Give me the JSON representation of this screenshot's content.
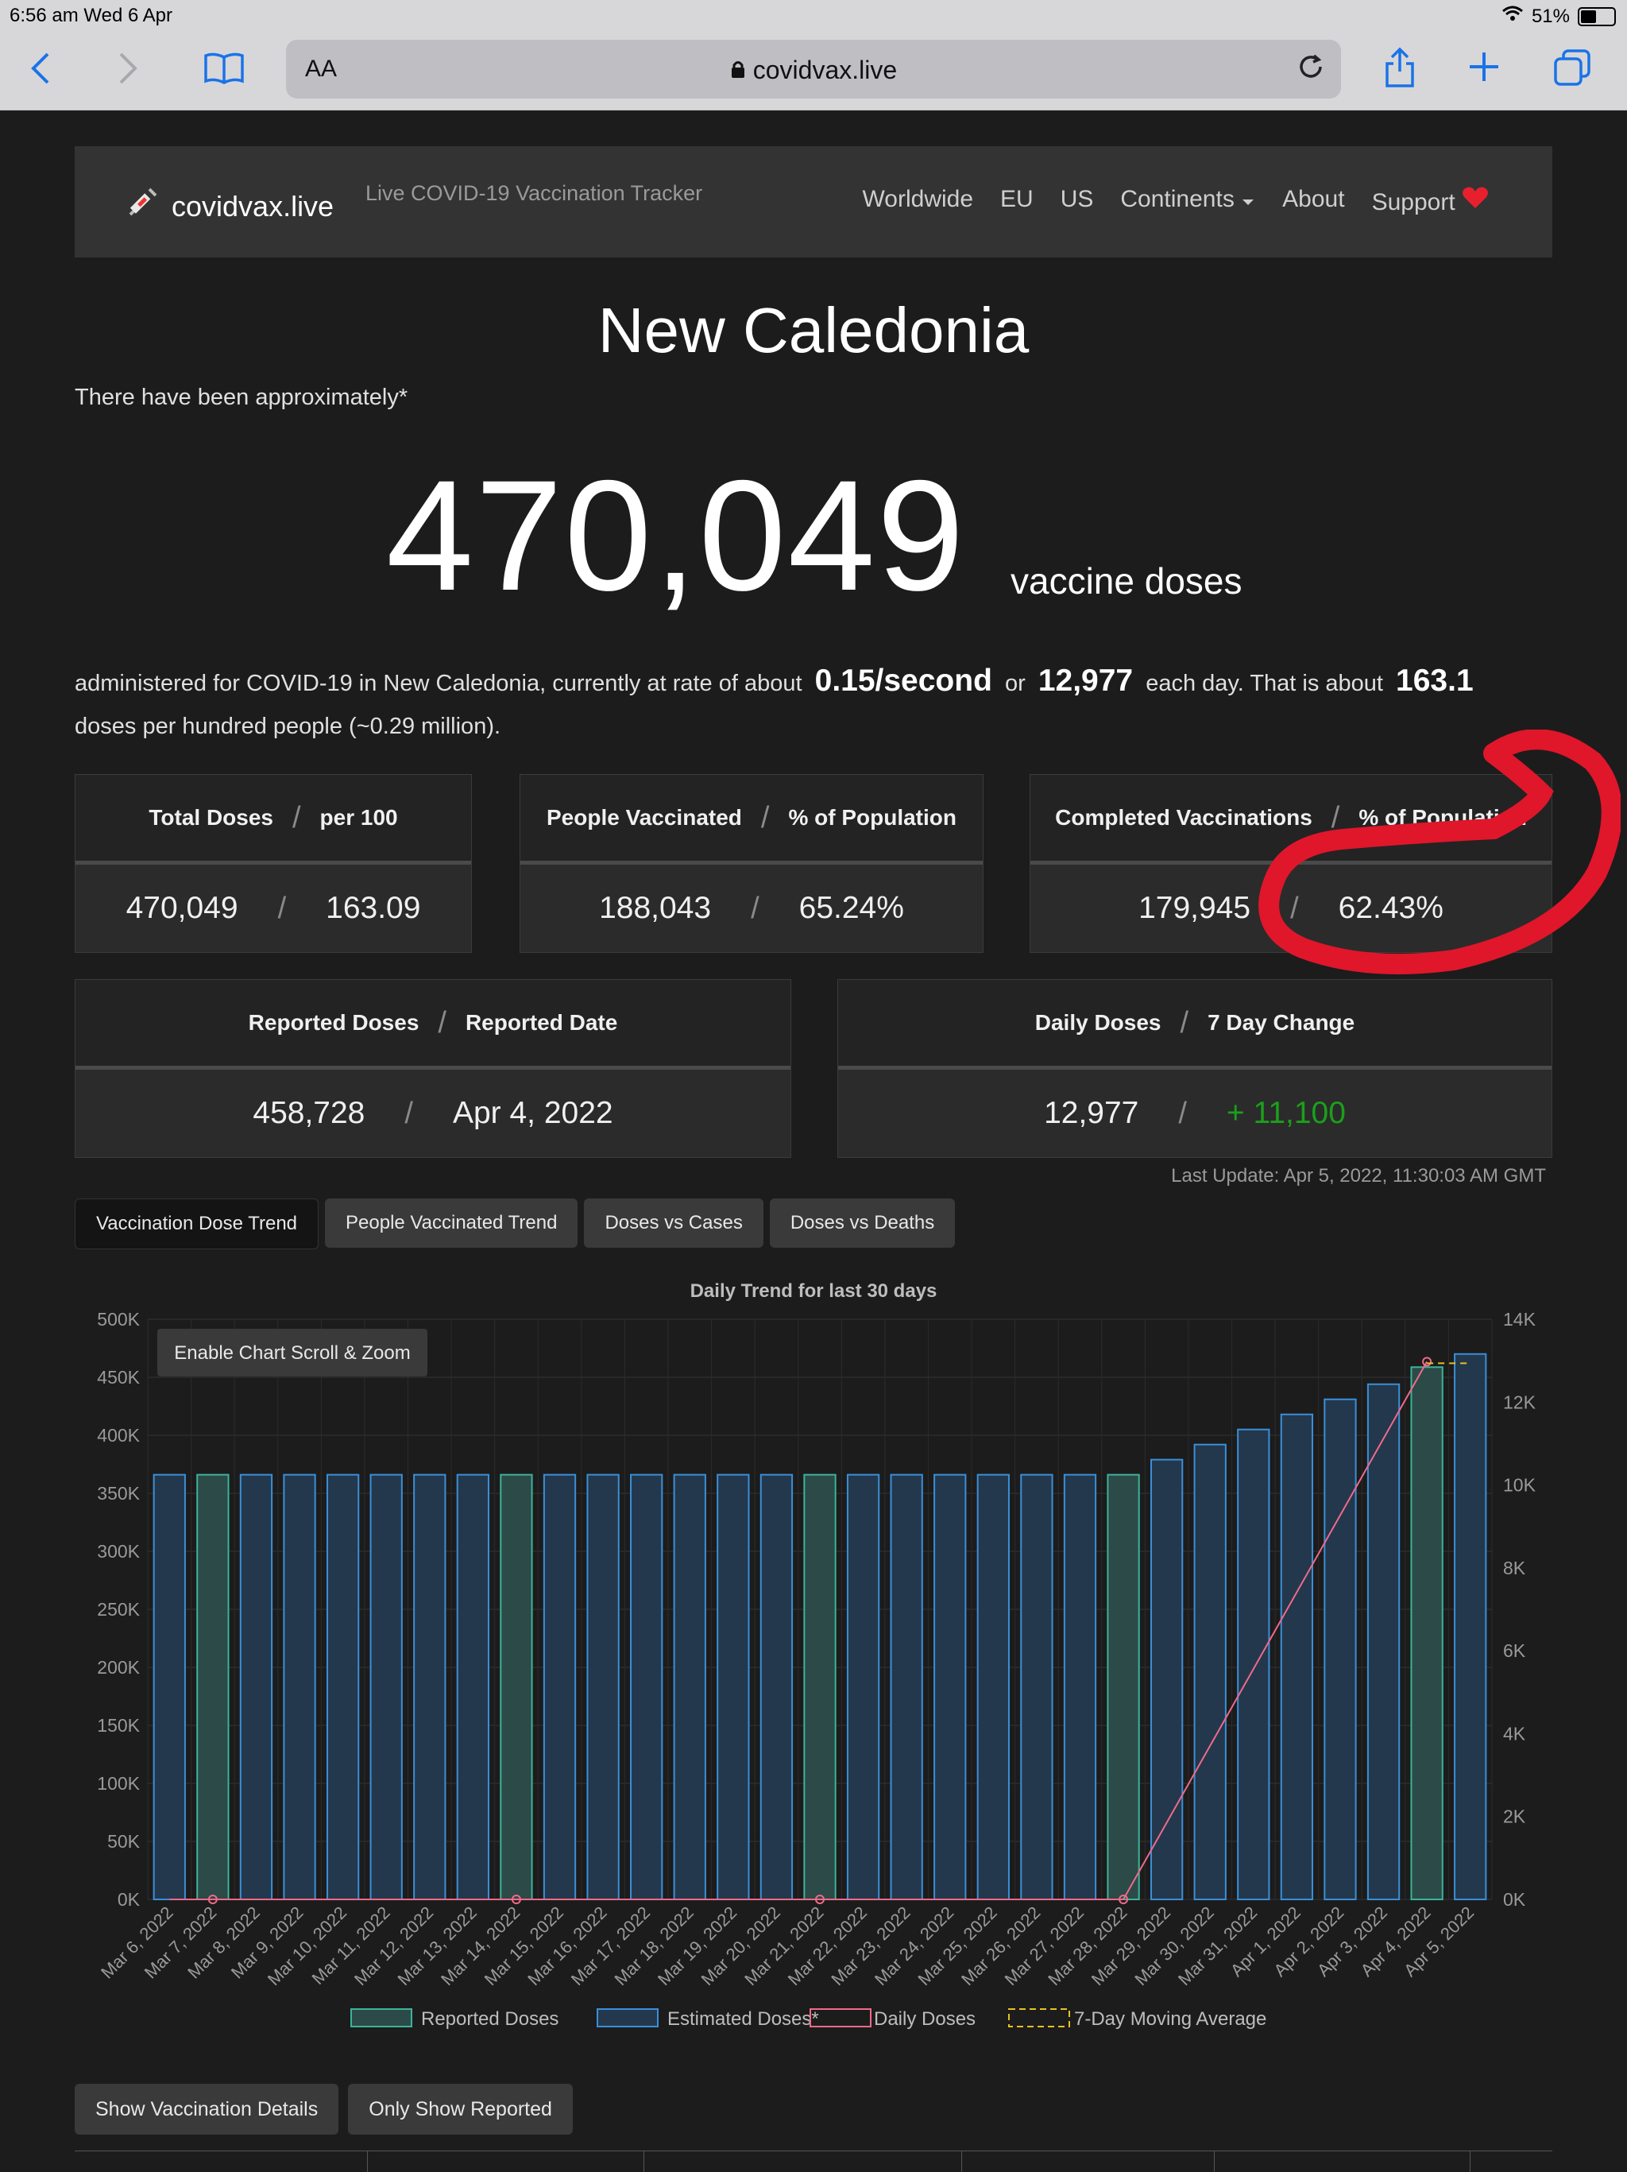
{
  "status": {
    "time": "6:56 am  Wed 6 Apr",
    "battery": "51%",
    "battery_level": 0.51
  },
  "safari": {
    "text_size": "AA",
    "url": "covidvax.live"
  },
  "nav": {
    "brand": "covidvax.live",
    "tagline": "Live COVID-19 Vaccination Tracker",
    "links": [
      "Worldwide",
      "EU",
      "US",
      "Continents",
      "About",
      "Support"
    ]
  },
  "country": "New Caledonia",
  "intro": "There have been approximately*",
  "big_number": "470,049",
  "big_suffix": "vaccine doses",
  "rate": {
    "text1": "administered for COVID-19 in New Caledonia, currently at rate of about",
    "per_second": "0.15/second",
    "or": "or",
    "per_day": "12,977",
    "text2": "each day.  That is about",
    "per_hundred": "163.1",
    "text3": "doses per hundred people (~0.29 million)."
  },
  "cards": {
    "total": {
      "h1": "Total Doses",
      "h2": "per 100",
      "v1": "470,049",
      "v2": "163.09"
    },
    "people": {
      "h1": "People Vaccinated",
      "h2": "% of Population",
      "v1": "188,043",
      "v2": "65.24%"
    },
    "completed": {
      "h1": "Completed Vaccinations",
      "h2": "% of Population",
      "v1": "179,945",
      "v2": "62.43%"
    },
    "reported": {
      "h1": "Reported Doses",
      "h2": "Reported Date",
      "v1": "458,728",
      "v2": "Apr 4, 2022"
    },
    "daily": {
      "h1": "Daily Doses",
      "h2": "7 Day Change",
      "v1": "12,977",
      "v2": "+ 11,100"
    }
  },
  "slash": "/",
  "last_update": "Last Update: Apr 5, 2022, 11:30:03 AM GMT",
  "tabs": [
    "Vaccination Dose Trend",
    "People Vaccinated Trend",
    "Doses vs Cases",
    "Doses vs Deaths"
  ],
  "zoom_button": "Enable Chart Scroll & Zoom",
  "buttons": {
    "details": "Show Vaccination Details",
    "reported": "Only Show Reported"
  },
  "colors": {
    "reported_bar": "#3cb39a",
    "estimated_bar": "#3a8fd8",
    "daily_line": "#f06a8a",
    "moving_avg": "#e8c020",
    "positive_change": "#1aa01a",
    "annotation": "#e0162b"
  },
  "chart_data": {
    "type": "bar",
    "title": "Daily Trend for last 30 days",
    "categories": [
      "Mar 6, 2022",
      "Mar 7, 2022",
      "Mar 8, 2022",
      "Mar 9, 2022",
      "Mar 10, 2022",
      "Mar 11, 2022",
      "Mar 12, 2022",
      "Mar 13, 2022",
      "Mar 14, 2022",
      "Mar 15, 2022",
      "Mar 16, 2022",
      "Mar 17, 2022",
      "Mar 18, 2022",
      "Mar 19, 2022",
      "Mar 20, 2022",
      "Mar 21, 2022",
      "Mar 22, 2022",
      "Mar 23, 2022",
      "Mar 24, 2022",
      "Mar 25, 2022",
      "Mar 26, 2022",
      "Mar 27, 2022",
      "Mar 28, 2022",
      "Mar 29, 2022",
      "Mar 30, 2022",
      "Mar 31, 2022",
      "Apr 1, 2022",
      "Apr 2, 2022",
      "Apr 3, 2022",
      "Apr 4, 2022",
      "Apr 5, 2022"
    ],
    "y_left": {
      "min": 0,
      "max": 500000,
      "ticks": [
        "0K",
        "50K",
        "100K",
        "150K",
        "200K",
        "250K",
        "300K",
        "350K",
        "400K",
        "450K",
        "500K"
      ]
    },
    "y_right": {
      "min": 0,
      "max": 14000,
      "ticks": [
        "0K",
        "2K",
        "4K",
        "6K",
        "8K",
        "10K",
        "12K",
        "14K"
      ]
    },
    "series": [
      {
        "name": "Reported Doses",
        "axis": "left",
        "style": "bar",
        "values": [
          null,
          366000,
          null,
          null,
          null,
          null,
          null,
          null,
          366000,
          null,
          null,
          null,
          null,
          null,
          null,
          366000,
          null,
          null,
          null,
          null,
          null,
          null,
          366000,
          null,
          null,
          null,
          null,
          null,
          null,
          458728,
          null
        ]
      },
      {
        "name": "Estimated Doses*",
        "axis": "left",
        "style": "bar",
        "values": [
          366000,
          null,
          366000,
          366000,
          366000,
          366000,
          366000,
          366000,
          null,
          366000,
          366000,
          366000,
          366000,
          366000,
          366000,
          null,
          366000,
          366000,
          366000,
          366000,
          366000,
          366000,
          null,
          379000,
          392000,
          405000,
          418000,
          431000,
          444000,
          null,
          470049
        ]
      },
      {
        "name": "Daily Doses",
        "axis": "right",
        "style": "line",
        "values": [
          0,
          0,
          0,
          0,
          0,
          0,
          0,
          0,
          0,
          0,
          0,
          0,
          0,
          0,
          0,
          0,
          0,
          0,
          0,
          0,
          0,
          0,
          0,
          null,
          null,
          null,
          null,
          null,
          null,
          12977,
          null
        ]
      },
      {
        "name": "7-Day Moving Average",
        "axis": "right",
        "style": "dashed-line",
        "values": [
          null,
          null,
          null,
          null,
          null,
          null,
          null,
          null,
          null,
          null,
          null,
          null,
          null,
          null,
          null,
          null,
          null,
          null,
          null,
          null,
          null,
          null,
          null,
          null,
          null,
          null,
          null,
          null,
          null,
          12977,
          12977
        ]
      }
    ],
    "marked_points": [
      "Mar 7, 2022",
      "Mar 14, 2022",
      "Mar 21, 2022",
      "Mar 28, 2022",
      "Apr 4, 2022"
    ],
    "legend": "bottom",
    "grid": true
  }
}
